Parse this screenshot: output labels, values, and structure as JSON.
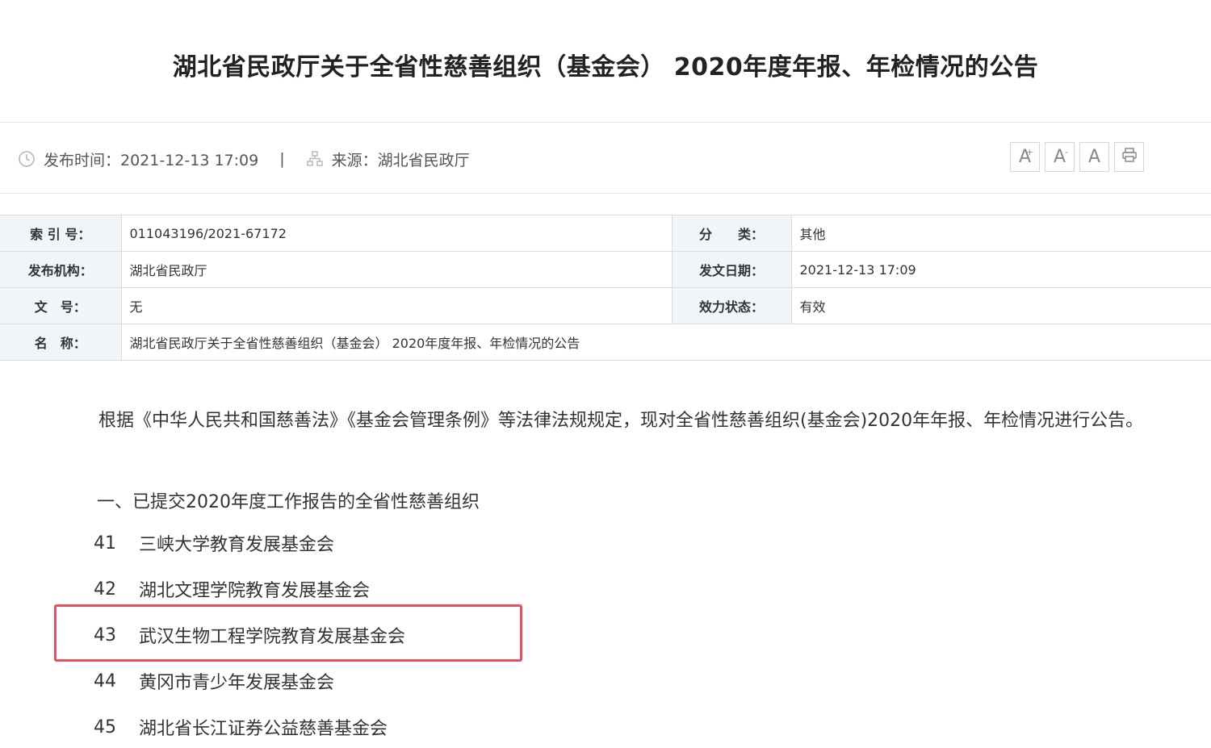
{
  "article": {
    "title": "湖北省民政厅关于全省性慈善组织（基金会） 2020年度年报、年检情况的公告",
    "publish_label": "发布时间：2021-12-13 17:09",
    "source_label": "来源：湖北省民政厅",
    "meta_separator": "|"
  },
  "font_tools": {
    "increase": "A",
    "increase_sup": "+",
    "decrease": "A",
    "decrease_sup": "-",
    "reset": "A"
  },
  "info_table": {
    "rows": [
      {
        "l1": "索 引 号：",
        "v1": "011043196/2021-67172",
        "l2": "分　　类：",
        "v2": "其他"
      },
      {
        "l1": "发布机构：",
        "v1": "湖北省民政厅",
        "l2": "发文日期：",
        "v2": "2021-12-13 17:09"
      },
      {
        "l1": "文　号：",
        "v1": "无",
        "l2": "效力状态：",
        "v2": "有效"
      },
      {
        "l1": "名　称：",
        "v1": "湖北省民政厅关于全省性慈善组织（基金会） 2020年度年报、年检情况的公告"
      }
    ]
  },
  "body": {
    "intro": "根据《中华人民共和国慈善法》《基金会管理条例》等法律法规规定，现对全省性慈善组织(基金会)2020年年报、年检情况进行公告。",
    "section_heading": "一、已提交2020年度工作报告的全省性慈善组织",
    "items": [
      {
        "num": "41",
        "name": "三峡大学教育发展基金会"
      },
      {
        "num": "42",
        "name": "湖北文理学院教育发展基金会"
      },
      {
        "num": "43",
        "name": "武汉生物工程学院教育发展基金会"
      },
      {
        "num": "44",
        "name": "黄冈市青少年发展基金会"
      },
      {
        "num": "45",
        "name": "湖北省长江证券公益慈善基金会"
      }
    ]
  },
  "colors": {
    "highlight": "#e8505e",
    "label_bg": "#f1f5fa"
  }
}
